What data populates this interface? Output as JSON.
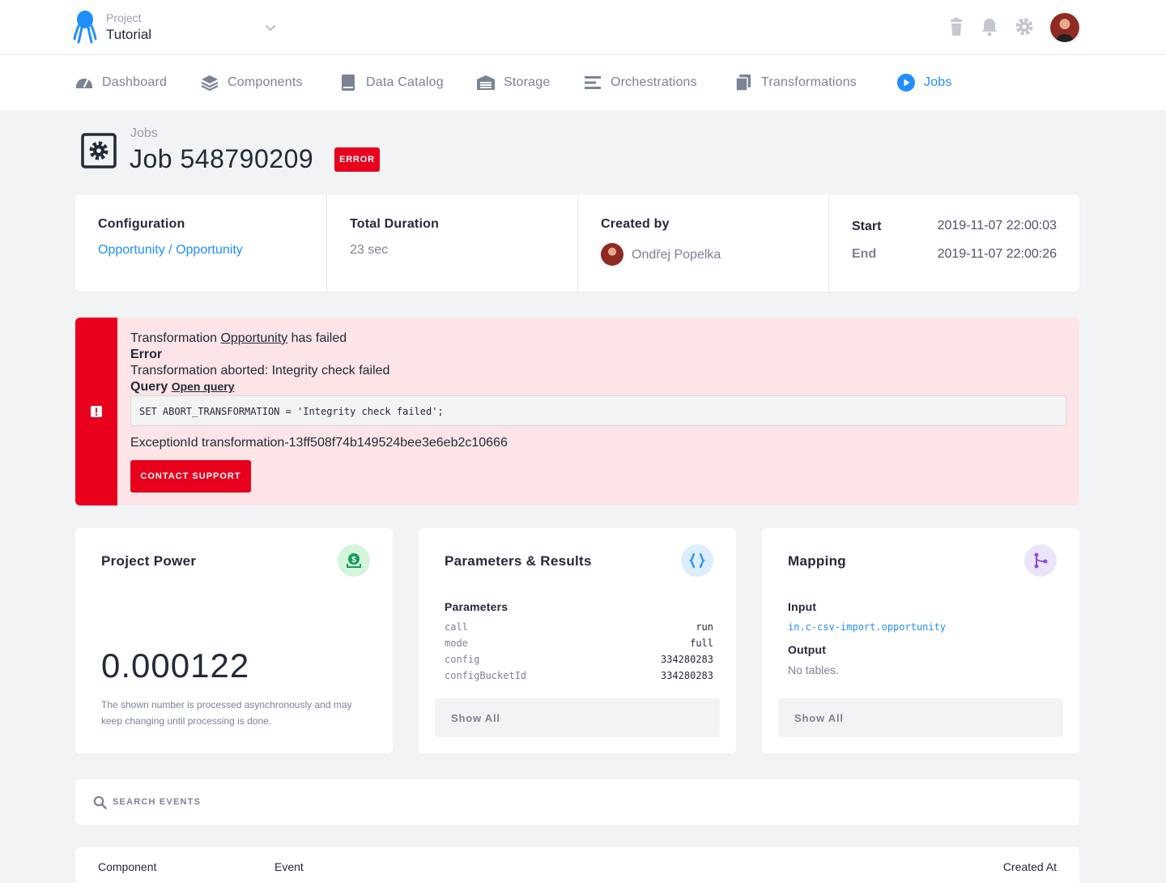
{
  "header": {
    "project_label": "Project",
    "project_name": "Tutorial",
    "icons": [
      "trash-icon",
      "bell-icon",
      "gear-icon",
      "user-avatar"
    ]
  },
  "nav": {
    "items": [
      {
        "label": "Dashboard",
        "icon": "speedometer-icon"
      },
      {
        "label": "Components",
        "icon": "layers-icon"
      },
      {
        "label": "Data Catalog",
        "icon": "book-icon"
      },
      {
        "label": "Storage",
        "icon": "warehouse-icon"
      },
      {
        "label": "Orchestrations",
        "icon": "bars-icon"
      },
      {
        "label": "Transformations",
        "icon": "copy-icon"
      },
      {
        "label": "Jobs",
        "icon": "play-circle-icon",
        "active": true
      }
    ]
  },
  "page": {
    "breadcrumb": "Jobs",
    "title": "Job 548790209",
    "status_badge": "ERROR"
  },
  "info": {
    "configuration_label": "Configuration",
    "configuration_link_1": "Opportunity",
    "configuration_sep": "/",
    "configuration_link_2": "Opportunity",
    "duration_label": "Total Duration",
    "duration_value": "23 sec",
    "created_by_label": "Created by",
    "created_by_name": "Ondřej Popelka",
    "start_label": "Start",
    "start_value": "2019-11-07 22:00:03",
    "end_label": "End",
    "end_value": "2019-11-07 22:00:26"
  },
  "alert": {
    "line1_prefix": "Transformation",
    "line1_link": "Opportunity",
    "line1_suffix": "has failed",
    "error_heading": "Error",
    "error_message": "Transformation aborted: Integrity check failed",
    "query_heading": "Query",
    "open_query": "Open query",
    "query_code": "SET ABORT_TRANSFORMATION = 'Integrity check failed';",
    "exception": "ExceptionId transformation-13ff508f74b149524bee3e6eb2c10666",
    "support_button": "CONTACT SUPPORT"
  },
  "power": {
    "title": "Project Power",
    "value": "0.000122",
    "note": "The shown number is processed asynchronously and may keep changing until processing is done."
  },
  "params": {
    "title": "Parameters & Results",
    "subheading": "Parameters",
    "rows": [
      {
        "key": "call",
        "value": "run"
      },
      {
        "key": "mode",
        "value": "full"
      },
      {
        "key": "config",
        "value": "334280283"
      },
      {
        "key": "configBucketId",
        "value": "334280283"
      }
    ],
    "show_all": "Show All"
  },
  "mapping": {
    "title": "Mapping",
    "input_label": "Input",
    "input_value": "in.c-csv-import.opportunity",
    "output_label": "Output",
    "output_value": "No tables.",
    "show_all": "Show All"
  },
  "search": {
    "placeholder": "SEARCH EVENTS"
  },
  "events_table": {
    "columns": [
      "Component",
      "Event",
      "Created At"
    ]
  },
  "colors": {
    "accent": "#1f8fff",
    "danger": "#e8001c",
    "danger_bg": "#fde4e6",
    "power_icon_bg": "#d4f5dc",
    "params_icon_bg": "#dcedfd",
    "mapping_icon_bg": "#ece4fb"
  }
}
